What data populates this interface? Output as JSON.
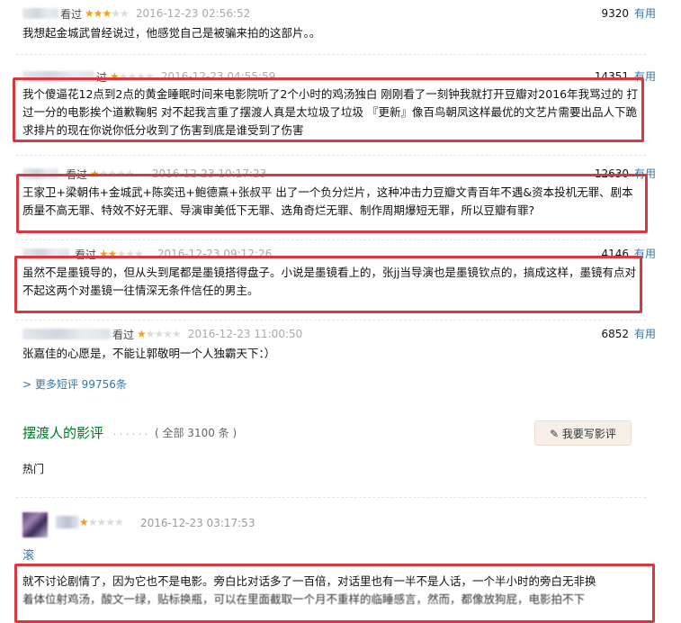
{
  "comments": [
    {
      "seen": "看过",
      "rating": 3,
      "time": "2016-12-23 02:56:52",
      "votes": "9320",
      "useful": "有用",
      "text": "我想起金城武曾经说过，他感觉自己是被骗来拍的这部片。。"
    },
    {
      "seen": "过",
      "rating": 1,
      "time": "2016-12-23 04:55:59",
      "votes": "14351",
      "useful": "有用",
      "text": "我个傻逼花12点到2点的黄金睡眠时间来电影院听了2个小时的鸡汤独白 刚刚看了一刻钟我就打开豆瓣对2016年我骂过的 打过一分的电影挨个道歉鞠躬 对不起我言重了摆渡人真是太垃圾了垃圾 『更新』像百鸟朝凤这样最优的文艺片需要出品人下跪求排片的现在你说你低分收到了伤害到底是谁受到了伤害"
    },
    {
      "seen": "看过",
      "rating": 1,
      "time": "2016-12-23 10:17:23",
      "votes": "12630",
      "useful": "有用",
      "text": "王家卫+梁朝伟+金城武+陈奕迅+鲍德熹+张叔平 出了一个负分烂片，这种冲击力豆瓣文青百年不遇&资本投机无罪、剧本质量不高无罪、特效不好无罪、导演审美低下无罪、选角奇烂无罪、制作周期爆短无罪，所以豆瓣有罪?"
    },
    {
      "seen": "看过",
      "rating": 2,
      "time": "2016-12-23 09:12:26",
      "votes": "4146",
      "useful": "有用",
      "text": "虽然不是墨镜导的，但从头到尾都是墨镜搭得盘子。小说是墨镜看上的，张jj当导演也是墨镜钦点的，搞成这样，墨镜有点对不起这两个对墨镜一往情深无条件信任的男主。"
    },
    {
      "seen": "看过",
      "rating": 1,
      "time": "2016-12-23 11:00:50",
      "votes": "6852",
      "useful": "有用",
      "text": "张嘉佳的心愿是，不能让郭敬明一个人独霸天下：）"
    }
  ],
  "more_link": "> 更多短评 99756条",
  "reviews_section": {
    "title": "摆渡人的影评",
    "dots": "· · · · · ·",
    "count_text": "( 全部 3100 条 )",
    "write_button": "✎ 我要写影评",
    "hot_label": "热门"
  },
  "review": {
    "rating": 1,
    "time": "2016-12-23 03:17:53",
    "title": "滚",
    "body_line1": "就不讨论剧情了，因为它也不是电影。旁白比对话多了一百倍，对话里也有一半不是人话，一个半小时的旁白无非换",
    "body_line2": "着体位射鸡汤，酸文一绿，贴标换瓶，可以在里面截取一个月不重样的临睡感言，然而，都像放狗屁，电影拍不下"
  },
  "colors": {
    "link": "#3377aa",
    "star": "#f4a012",
    "highlight_box": "#d9383f",
    "section_title": "#007722"
  }
}
